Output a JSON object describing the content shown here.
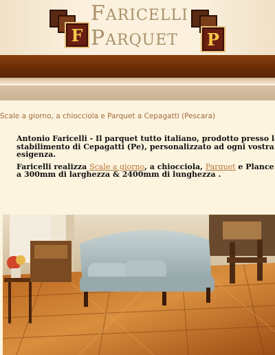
{
  "brand": {
    "logo_letter_left": "F",
    "logo_letter_right": "P",
    "line1_cap": "F",
    "line1_rest": "ARICELLI",
    "line2_cap": "P",
    "line2_rest": "ARQUET"
  },
  "breadcrumb": "Scale a giorno, a chiocciola e Parquet a Cepagatti (Pescara)",
  "intro": {
    "para1_line1": "Antonio Faricelli - Il parquet tutto italiano, prodotto presso lo",
    "para1_line2": "stabilimento di Cepagatti (Pe), personalizzato ad ogni vostra",
    "para1_line3": "esigenza.",
    "para2_prefix": "Faricelli realizza ",
    "link_scale": "Scale a giorno",
    "para2_mid1": ", a chiocciola, ",
    "link_parquet": "Parquet",
    "para2_mid2": " e Plance ex",
    "para2_line2": "a 300mm di larghezza & 2400mm di lunghezza ."
  },
  "colors": {
    "nav_brown": "#6b2c06",
    "link": "#b5763a",
    "logo_gold": "#f4c64a"
  }
}
